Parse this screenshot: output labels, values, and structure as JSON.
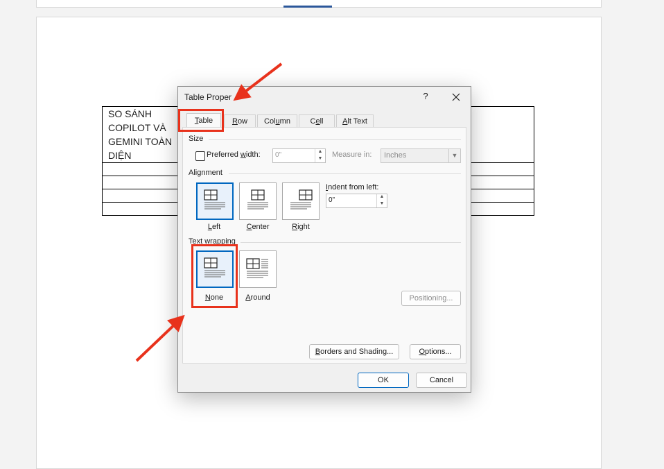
{
  "document": {
    "table_cell_text": "SO SÁNH COPILOT VÀ GEMINI TOÀN DIỆN"
  },
  "dialog": {
    "title": "Table Properties",
    "help_label": "?",
    "tabs": [
      {
        "label": "Table",
        "mnemonic": "T",
        "rest": "able"
      },
      {
        "label": "Row",
        "mnemonic": "R",
        "rest": "ow"
      },
      {
        "label": "Column",
        "pre": "Col",
        "mnemonic": "u",
        "rest": "mn"
      },
      {
        "label": "Cell",
        "mnemonic": "e",
        "pre": "C",
        "rest": "ll"
      },
      {
        "label": "Alt Text",
        "mnemonic": "A",
        "rest": "lt Text"
      }
    ],
    "size": {
      "section": "Size",
      "preferred_width_pre": "Preferred ",
      "preferred_width_mn": "w",
      "preferred_width_post": "idth:",
      "preferred_width_value": "0\"",
      "measure_in_label": "Measure in:",
      "measure_in_value": "Inches"
    },
    "alignment": {
      "section": "Alignment",
      "options": [
        {
          "label": "Left",
          "mnemonic": "L",
          "rest": "eft",
          "selected": true
        },
        {
          "label": "Center",
          "mnemonic": "C",
          "rest": "enter",
          "selected": false
        },
        {
          "label": "Right",
          "mnemonic": "R",
          "rest": "ight",
          "selected": false
        }
      ],
      "indent_label_mn": "I",
      "indent_label_rest": "ndent from left:",
      "indent_value": "0\""
    },
    "text_wrapping": {
      "section": "Text wrapping",
      "options": [
        {
          "label": "None",
          "mnemonic": "N",
          "rest": "one",
          "selected": true
        },
        {
          "label": "Around",
          "mnemonic": "A",
          "rest": "round",
          "selected": false
        }
      ],
      "positioning_label": "Positioning..."
    },
    "buttons": {
      "borders_mn": "B",
      "borders_rest": "orders and Shading...",
      "options_mn": "O",
      "options_rest": "ptions...",
      "ok": "OK",
      "cancel": "Cancel"
    }
  },
  "colors": {
    "accent": "#0067c0",
    "annotation_red": "#e8321c"
  }
}
